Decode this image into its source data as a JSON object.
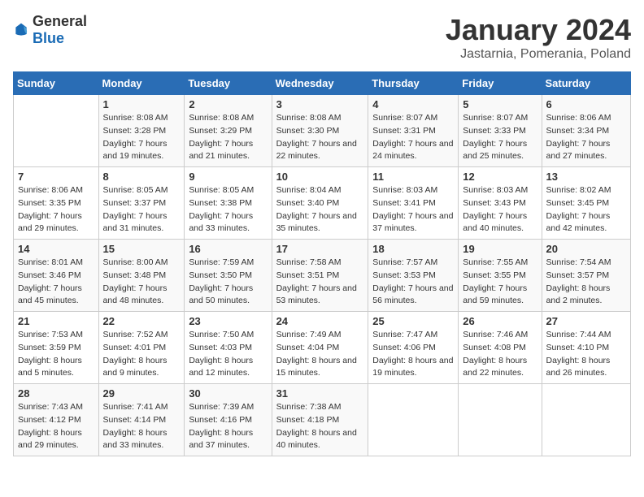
{
  "header": {
    "logo_general": "General",
    "logo_blue": "Blue",
    "title": "January 2024",
    "location": "Jastarnia, Pomerania, Poland"
  },
  "calendar": {
    "days_of_week": [
      "Sunday",
      "Monday",
      "Tuesday",
      "Wednesday",
      "Thursday",
      "Friday",
      "Saturday"
    ],
    "weeks": [
      [
        {
          "day": "",
          "sunrise": "",
          "sunset": "",
          "daylight": ""
        },
        {
          "day": "1",
          "sunrise": "Sunrise: 8:08 AM",
          "sunset": "Sunset: 3:28 PM",
          "daylight": "Daylight: 7 hours and 19 minutes."
        },
        {
          "day": "2",
          "sunrise": "Sunrise: 8:08 AM",
          "sunset": "Sunset: 3:29 PM",
          "daylight": "Daylight: 7 hours and 21 minutes."
        },
        {
          "day": "3",
          "sunrise": "Sunrise: 8:08 AM",
          "sunset": "Sunset: 3:30 PM",
          "daylight": "Daylight: 7 hours and 22 minutes."
        },
        {
          "day": "4",
          "sunrise": "Sunrise: 8:07 AM",
          "sunset": "Sunset: 3:31 PM",
          "daylight": "Daylight: 7 hours and 24 minutes."
        },
        {
          "day": "5",
          "sunrise": "Sunrise: 8:07 AM",
          "sunset": "Sunset: 3:33 PM",
          "daylight": "Daylight: 7 hours and 25 minutes."
        },
        {
          "day": "6",
          "sunrise": "Sunrise: 8:06 AM",
          "sunset": "Sunset: 3:34 PM",
          "daylight": "Daylight: 7 hours and 27 minutes."
        }
      ],
      [
        {
          "day": "7",
          "sunrise": "Sunrise: 8:06 AM",
          "sunset": "Sunset: 3:35 PM",
          "daylight": "Daylight: 7 hours and 29 minutes."
        },
        {
          "day": "8",
          "sunrise": "Sunrise: 8:05 AM",
          "sunset": "Sunset: 3:37 PM",
          "daylight": "Daylight: 7 hours and 31 minutes."
        },
        {
          "day": "9",
          "sunrise": "Sunrise: 8:05 AM",
          "sunset": "Sunset: 3:38 PM",
          "daylight": "Daylight: 7 hours and 33 minutes."
        },
        {
          "day": "10",
          "sunrise": "Sunrise: 8:04 AM",
          "sunset": "Sunset: 3:40 PM",
          "daylight": "Daylight: 7 hours and 35 minutes."
        },
        {
          "day": "11",
          "sunrise": "Sunrise: 8:03 AM",
          "sunset": "Sunset: 3:41 PM",
          "daylight": "Daylight: 7 hours and 37 minutes."
        },
        {
          "day": "12",
          "sunrise": "Sunrise: 8:03 AM",
          "sunset": "Sunset: 3:43 PM",
          "daylight": "Daylight: 7 hours and 40 minutes."
        },
        {
          "day": "13",
          "sunrise": "Sunrise: 8:02 AM",
          "sunset": "Sunset: 3:45 PM",
          "daylight": "Daylight: 7 hours and 42 minutes."
        }
      ],
      [
        {
          "day": "14",
          "sunrise": "Sunrise: 8:01 AM",
          "sunset": "Sunset: 3:46 PM",
          "daylight": "Daylight: 7 hours and 45 minutes."
        },
        {
          "day": "15",
          "sunrise": "Sunrise: 8:00 AM",
          "sunset": "Sunset: 3:48 PM",
          "daylight": "Daylight: 7 hours and 48 minutes."
        },
        {
          "day": "16",
          "sunrise": "Sunrise: 7:59 AM",
          "sunset": "Sunset: 3:50 PM",
          "daylight": "Daylight: 7 hours and 50 minutes."
        },
        {
          "day": "17",
          "sunrise": "Sunrise: 7:58 AM",
          "sunset": "Sunset: 3:51 PM",
          "daylight": "Daylight: 7 hours and 53 minutes."
        },
        {
          "day": "18",
          "sunrise": "Sunrise: 7:57 AM",
          "sunset": "Sunset: 3:53 PM",
          "daylight": "Daylight: 7 hours and 56 minutes."
        },
        {
          "day": "19",
          "sunrise": "Sunrise: 7:55 AM",
          "sunset": "Sunset: 3:55 PM",
          "daylight": "Daylight: 7 hours and 59 minutes."
        },
        {
          "day": "20",
          "sunrise": "Sunrise: 7:54 AM",
          "sunset": "Sunset: 3:57 PM",
          "daylight": "Daylight: 8 hours and 2 minutes."
        }
      ],
      [
        {
          "day": "21",
          "sunrise": "Sunrise: 7:53 AM",
          "sunset": "Sunset: 3:59 PM",
          "daylight": "Daylight: 8 hours and 5 minutes."
        },
        {
          "day": "22",
          "sunrise": "Sunrise: 7:52 AM",
          "sunset": "Sunset: 4:01 PM",
          "daylight": "Daylight: 8 hours and 9 minutes."
        },
        {
          "day": "23",
          "sunrise": "Sunrise: 7:50 AM",
          "sunset": "Sunset: 4:03 PM",
          "daylight": "Daylight: 8 hours and 12 minutes."
        },
        {
          "day": "24",
          "sunrise": "Sunrise: 7:49 AM",
          "sunset": "Sunset: 4:04 PM",
          "daylight": "Daylight: 8 hours and 15 minutes."
        },
        {
          "day": "25",
          "sunrise": "Sunrise: 7:47 AM",
          "sunset": "Sunset: 4:06 PM",
          "daylight": "Daylight: 8 hours and 19 minutes."
        },
        {
          "day": "26",
          "sunrise": "Sunrise: 7:46 AM",
          "sunset": "Sunset: 4:08 PM",
          "daylight": "Daylight: 8 hours and 22 minutes."
        },
        {
          "day": "27",
          "sunrise": "Sunrise: 7:44 AM",
          "sunset": "Sunset: 4:10 PM",
          "daylight": "Daylight: 8 hours and 26 minutes."
        }
      ],
      [
        {
          "day": "28",
          "sunrise": "Sunrise: 7:43 AM",
          "sunset": "Sunset: 4:12 PM",
          "daylight": "Daylight: 8 hours and 29 minutes."
        },
        {
          "day": "29",
          "sunrise": "Sunrise: 7:41 AM",
          "sunset": "Sunset: 4:14 PM",
          "daylight": "Daylight: 8 hours and 33 minutes."
        },
        {
          "day": "30",
          "sunrise": "Sunrise: 7:39 AM",
          "sunset": "Sunset: 4:16 PM",
          "daylight": "Daylight: 8 hours and 37 minutes."
        },
        {
          "day": "31",
          "sunrise": "Sunrise: 7:38 AM",
          "sunset": "Sunset: 4:18 PM",
          "daylight": "Daylight: 8 hours and 40 minutes."
        },
        {
          "day": "",
          "sunrise": "",
          "sunset": "",
          "daylight": ""
        },
        {
          "day": "",
          "sunrise": "",
          "sunset": "",
          "daylight": ""
        },
        {
          "day": "",
          "sunrise": "",
          "sunset": "",
          "daylight": ""
        }
      ]
    ]
  }
}
